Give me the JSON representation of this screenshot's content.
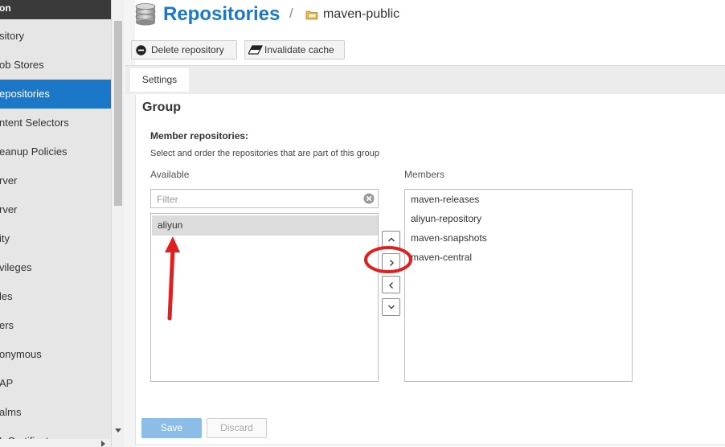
{
  "sidebar": {
    "header": "on",
    "items": [
      {
        "label": "sitory"
      },
      {
        "label": "ob Stores"
      },
      {
        "label": "epositories",
        "active": true
      },
      {
        "label": "ntent Selectors"
      },
      {
        "label": "eanup Policies"
      },
      {
        "label": "rver"
      },
      {
        "label": "rver"
      },
      {
        "label": "ity"
      },
      {
        "label": "vileges"
      },
      {
        "label": "les"
      },
      {
        "label": "ers"
      },
      {
        "label": "onymous"
      },
      {
        "label": "AP"
      },
      {
        "label": "alms"
      },
      {
        "label": "L Certificat"
      }
    ]
  },
  "header": {
    "title": "Repositories",
    "separator": "/",
    "repo_name": "maven-public"
  },
  "toolbar": {
    "delete_label": "Delete repository",
    "invalidate_label": "Invalidate cache"
  },
  "tabs": [
    {
      "label": "Settings",
      "active": true
    }
  ],
  "group": {
    "title": "Group",
    "member_label": "Member repositories:",
    "member_description": "Select and order the repositories that are part of this group",
    "available_header": "Available",
    "members_header": "Members",
    "filter_placeholder": "Filter",
    "available": [
      "aliyun"
    ],
    "members": [
      "maven-releases",
      "aliyun-repository",
      "maven-snapshots",
      "maven-central"
    ]
  },
  "actions": {
    "save_label": "Save",
    "discard_label": "Discard"
  },
  "colors": {
    "accent": "#1b77c8",
    "annotation": "#e02020",
    "save_button": "#8cbde6"
  },
  "icons": {
    "header": "database-icon",
    "breadcrumb": "folder-icon",
    "delete": "minus-circle-icon",
    "invalidate": "eraser-icon",
    "filter_clear": "clear-icon"
  }
}
